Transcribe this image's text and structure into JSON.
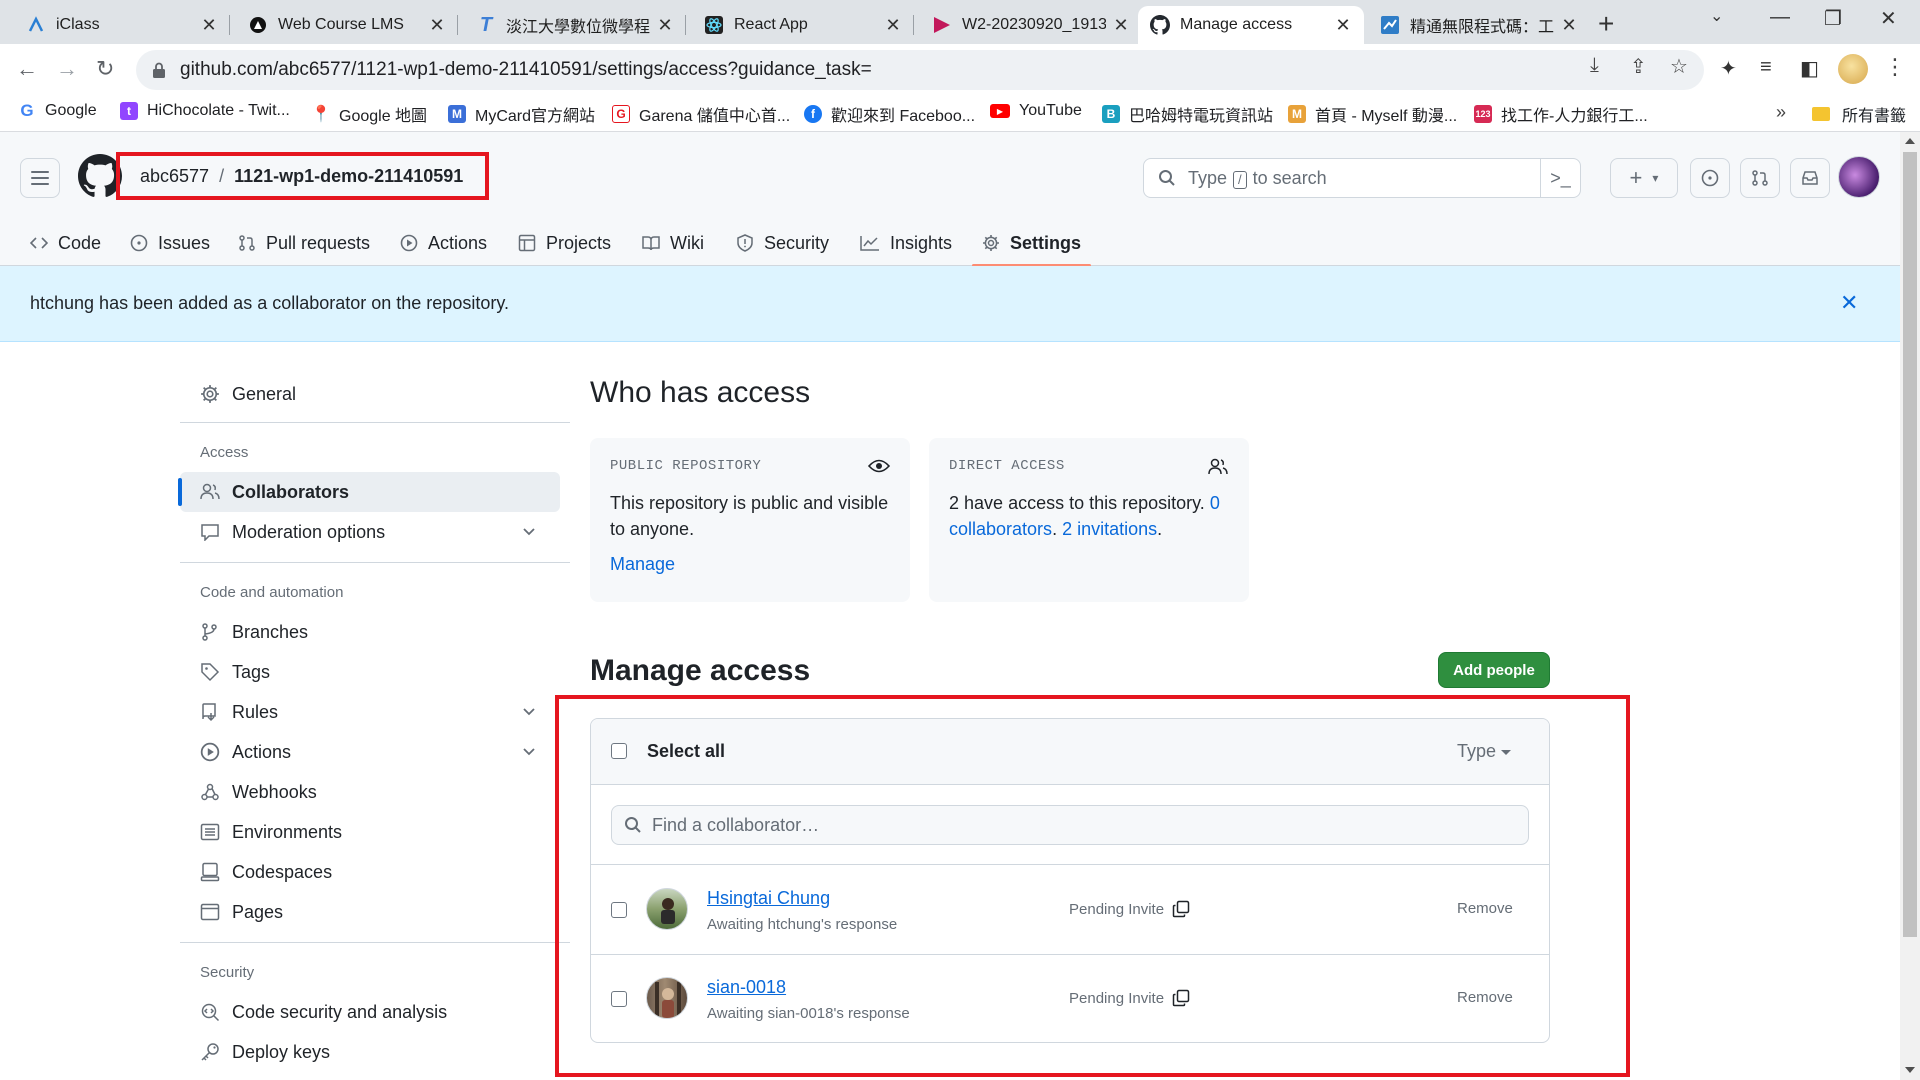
{
  "browser": {
    "tabs": [
      {
        "label": "iClass",
        "icon": "iclass-icon"
      },
      {
        "label": "Web Course LMS",
        "icon": "lms-icon"
      },
      {
        "label": "淡江大學數位微學程 |",
        "icon": "tku-icon"
      },
      {
        "label": "React App",
        "icon": "react-icon"
      },
      {
        "label": "W2-20230920_1913",
        "icon": "video-icon"
      },
      {
        "label": "Manage access",
        "icon": "github-icon"
      },
      {
        "label": "精通無限程式碼：工具",
        "icon": "site-icon"
      }
    ],
    "url": "github.com/abc6577/1121-wp1-demo-211410591/settings/access?guidance_task=",
    "bookmarks": [
      {
        "label": "Google",
        "color": "#4285f4"
      },
      {
        "label": "HiChocolate - Twit...",
        "color": "#9146ff"
      },
      {
        "label": "Google 地圖",
        "color": "#34a853"
      },
      {
        "label": "MyCard官方網站",
        "color": "#3b6fd8"
      },
      {
        "label": "Garena 儲值中心首...",
        "color": "#e5161f"
      },
      {
        "label": "歡迎來到 Faceboo...",
        "color": "#1877f2"
      },
      {
        "label": "YouTube",
        "color": "#ff0000"
      },
      {
        "label": "巴哈姆特電玩資訊站",
        "color": "#1a9fbf"
      },
      {
        "label": "首頁 - Myself 動漫...",
        "color": "#e8a23a"
      },
      {
        "label": "找工作-人力銀行工...",
        "color": "#d62a54"
      }
    ],
    "bookmarks_all": "所有書籤"
  },
  "github": {
    "owner": "abc6577",
    "repo": "1121-wp1-demo-211410591",
    "search_prefix": "Type",
    "search_key": "/",
    "search_suffix": "to search",
    "nav": [
      "Code",
      "Issues",
      "Pull requests",
      "Actions",
      "Projects",
      "Wiki",
      "Security",
      "Insights",
      "Settings"
    ],
    "flash": "htchung has been added as a collaborator on the repository."
  },
  "sidebar": {
    "general": "General",
    "group_access": "Access",
    "collaborators": "Collaborators",
    "moderation": "Moderation options",
    "group_code": "Code and automation",
    "branches": "Branches",
    "tags": "Tags",
    "rules": "Rules",
    "actions": "Actions",
    "webhooks": "Webhooks",
    "environments": "Environments",
    "codespaces": "Codespaces",
    "pages": "Pages",
    "group_security": "Security",
    "code_security": "Code security and analysis",
    "deploy_keys": "Deploy keys"
  },
  "main": {
    "who_title": "Who has access",
    "public_card": {
      "title": "PUBLIC REPOSITORY",
      "text": "This repository is public and visible to anyone.",
      "link": "Manage"
    },
    "direct_card": {
      "title": "DIRECT ACCESS",
      "count": "2",
      "text": "have access to this repository.",
      "collaborators_link": "0 collaborators",
      "invitations_link": "2 invitations"
    },
    "manage_title": "Manage access",
    "add_people": "Add people",
    "select_all": "Select all",
    "type_filter": "Type",
    "find_placeholder": "Find a collaborator…",
    "members": [
      {
        "name": "Hsingtai Chung",
        "sub": "Awaiting htchung's response",
        "status": "Pending Invite",
        "action": "Remove"
      },
      {
        "name": "sian-0018",
        "sub": "Awaiting sian-0018's response",
        "status": "Pending Invite",
        "action": "Remove"
      }
    ]
  }
}
